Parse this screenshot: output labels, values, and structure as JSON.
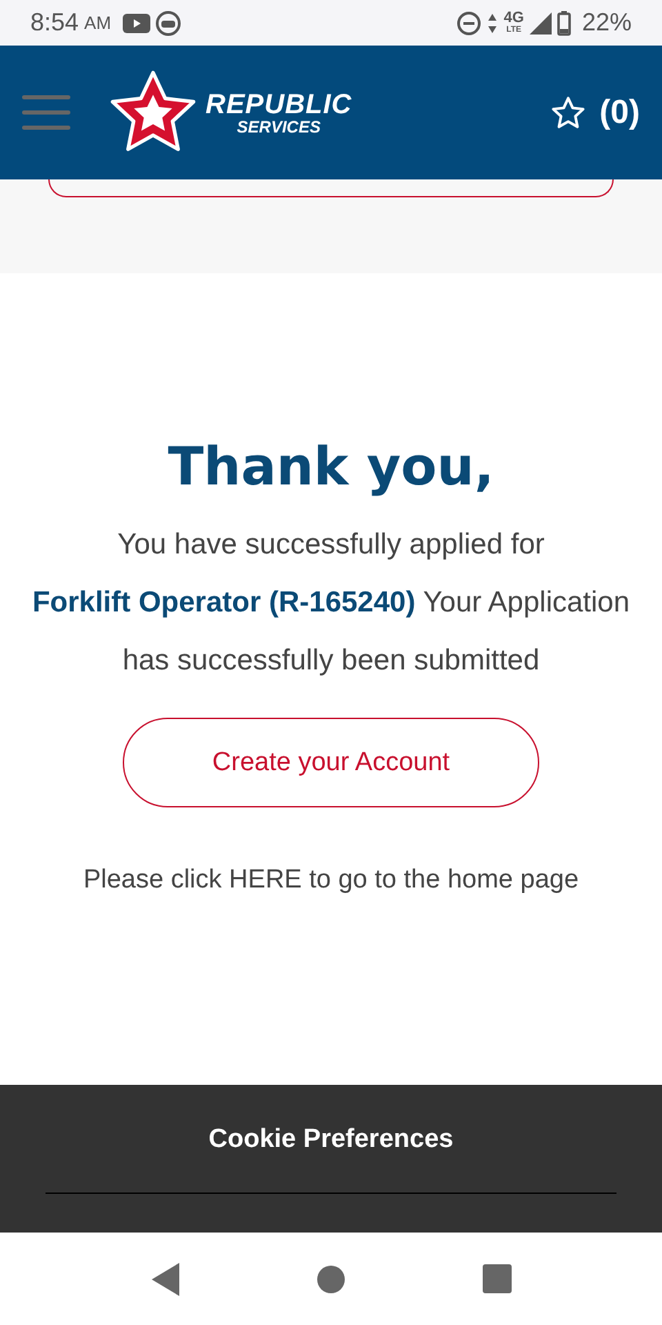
{
  "status_bar": {
    "time": "8:54",
    "meridiem": "AM",
    "network": "4G",
    "network_sub": "LTE",
    "battery": "22%"
  },
  "header": {
    "brand": "REPUBLIC",
    "brand_sub": "SERVICES",
    "favorites_count": "(0)"
  },
  "confirmation": {
    "title": "Thank you,",
    "intro": "You have successfully applied for",
    "job_link": "Forklift Operator (R-165240)",
    "message": "Your Application has successfully been submitted",
    "button": "Create your Account",
    "home_note": "Please click HERE to go to the home page"
  },
  "cookie_bar": {
    "label": "Cookie Preferences"
  }
}
